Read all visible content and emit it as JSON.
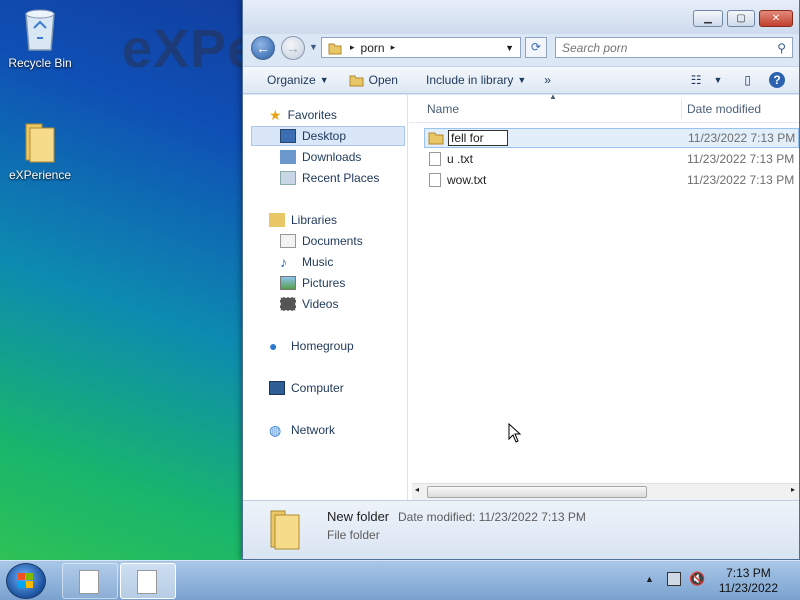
{
  "desktop": {
    "wallpaper_text": "eXPe",
    "icons": [
      {
        "label": "Recycle Bin",
        "icon": "recycle-bin-icon"
      },
      {
        "label": "eXPerience",
        "icon": "folder-icon"
      }
    ]
  },
  "window": {
    "breadcrumb": {
      "folder": "porn"
    },
    "search": {
      "placeholder": "Search porn"
    },
    "toolbar": {
      "organize": "Organize",
      "open": "Open",
      "include": "Include in library",
      "more": "»"
    },
    "nav": {
      "favorites": "Favorites",
      "desktop": "Desktop",
      "downloads": "Downloads",
      "recent": "Recent Places",
      "libraries": "Libraries",
      "documents": "Documents",
      "music": "Music",
      "pictures": "Pictures",
      "videos": "Videos",
      "homegroup": "Homegroup",
      "computer": "Computer",
      "network": "Network"
    },
    "columns": {
      "name": "Name",
      "date": "Date modified"
    },
    "files": [
      {
        "name": "fell for",
        "date": "11/23/2022 7:13 PM",
        "type": "folder",
        "renaming": true
      },
      {
        "name": "u .txt",
        "date": "11/23/2022 7:13 PM",
        "type": "text"
      },
      {
        "name": "wow.txt",
        "date": "11/23/2022 7:13 PM",
        "type": "text"
      }
    ],
    "details": {
      "name": "New folder",
      "meta": "Date modified: 11/23/2022 7:13 PM",
      "type": "File folder"
    }
  },
  "taskbar": {
    "clock": {
      "time": "7:13 PM",
      "date": "11/23/2022"
    },
    "tray_arrow": "▲"
  }
}
